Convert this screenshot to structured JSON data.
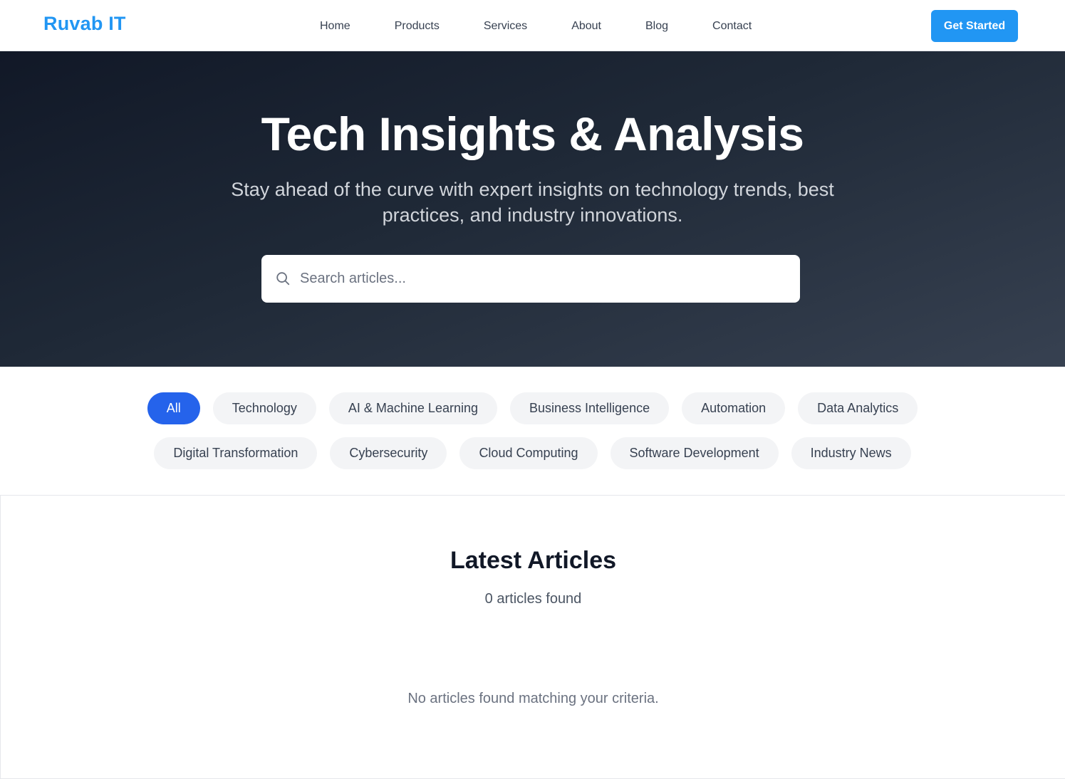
{
  "brand": {
    "logo": "Ruvab IT",
    "accent_color": "#2196f3"
  },
  "nav": {
    "links": [
      "Home",
      "Products",
      "Services",
      "About",
      "Blog",
      "Contact"
    ],
    "cta_label": "Get Started"
  },
  "hero": {
    "title": "Tech Insights & Analysis",
    "subtitle": "Stay ahead of the curve with expert insights on technology trends, best practices, and industry innovations.",
    "search": {
      "placeholder": "Search articles...",
      "value": "",
      "icon": "search-icon"
    }
  },
  "filters": {
    "active": "All",
    "active_color": "#2563eb",
    "row1": [
      "All",
      "Technology",
      "AI & Machine Learning",
      "Business Intelligence",
      "Automation",
      "Data Analytics"
    ],
    "row2": [
      "Digital Transformation",
      "Cybersecurity",
      "Cloud Computing",
      "Software Development",
      "Industry News"
    ]
  },
  "articles": {
    "title": "Latest Articles",
    "count_text": "0 articles found",
    "empty_message": "No articles found matching your criteria."
  }
}
